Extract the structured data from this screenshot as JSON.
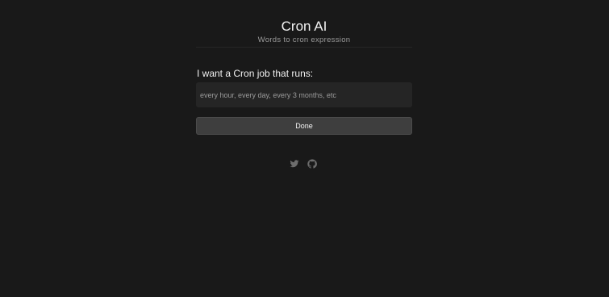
{
  "header": {
    "title": "Cron AI",
    "subtitle": "Words to cron expression"
  },
  "form": {
    "label": "I want a Cron job that runs:",
    "input_value": "",
    "input_placeholder": "every hour, every day, every 3 months, etc",
    "submit_label": "Done"
  },
  "footer": {
    "icons": [
      "twitter-icon",
      "github-icon"
    ]
  },
  "colors": {
    "background": "#191919",
    "input_background": "#252525",
    "button_background": "#3e3e3e",
    "icon": "#6d6d6d"
  }
}
